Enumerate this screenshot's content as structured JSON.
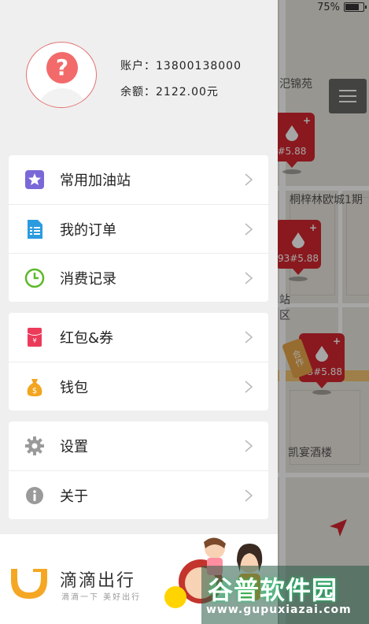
{
  "status_bar": {
    "battery": "75%",
    "battery_level": 0.75
  },
  "map": {
    "labels": [
      "汜锦苑",
      "桐梓林欧城1期",
      "凯宴酒楼",
      "站",
      "区"
    ],
    "markers": [
      {
        "price": "#5.88"
      },
      {
        "price": "93#5.88"
      },
      {
        "price": "93#5.88"
      }
    ],
    "tag": "合作"
  },
  "profile": {
    "account_label": "账户：",
    "account_value": "13800138000",
    "balance_label": "余额：",
    "balance_value": "2122.00元"
  },
  "menu": {
    "group1": [
      {
        "label": "常用加油站",
        "icon": "star-icon",
        "color": "#7b68d8"
      },
      {
        "label": "我的订单",
        "icon": "document-icon",
        "color": "#2b9be0"
      },
      {
        "label": "消费记录",
        "icon": "clock-icon",
        "color": "#5cb82a"
      }
    ],
    "group2": [
      {
        "label": "红包&券",
        "icon": "red-envelope-icon",
        "color": "#ec3b5a"
      },
      {
        "label": "钱包",
        "icon": "money-bag-icon",
        "color": "#f2a51f"
      }
    ],
    "group3": [
      {
        "label": "设置",
        "icon": "gear-icon",
        "color": "#9a9a9a"
      },
      {
        "label": "关于",
        "icon": "info-icon",
        "color": "#9a9a9a"
      }
    ]
  },
  "brand": {
    "name": "滴滴出行",
    "slogan": "滴滴一下 美好出行",
    "accent": "#f5a623"
  },
  "watermark": {
    "title": "谷普软件园",
    "url": "www.gupuxiazai.com"
  }
}
